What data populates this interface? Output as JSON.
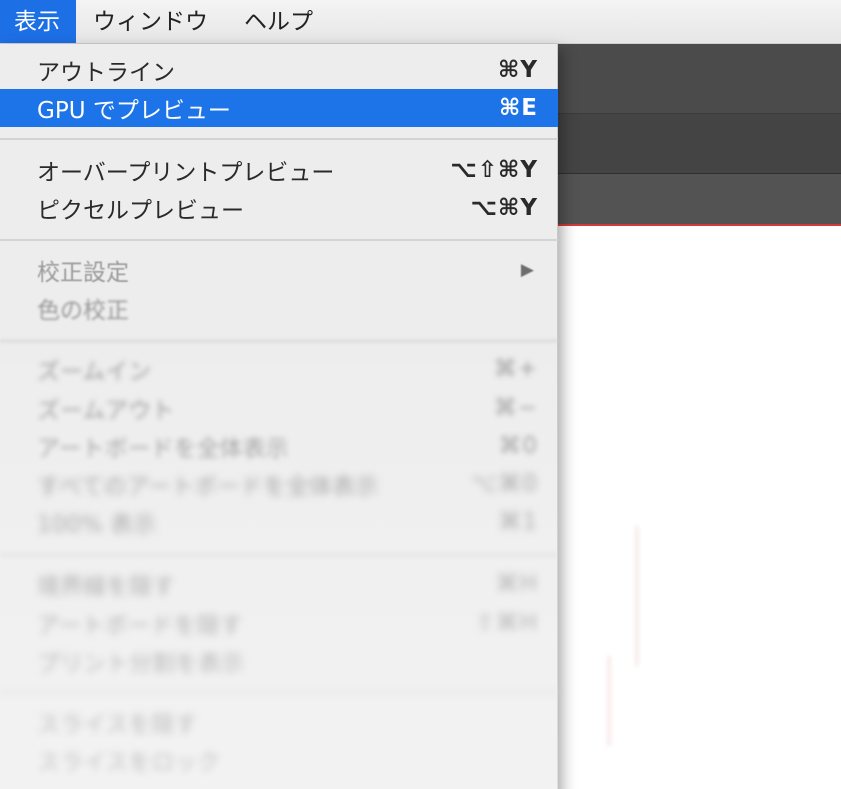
{
  "menubar": {
    "items": [
      {
        "label": "表示",
        "active": true
      },
      {
        "label": "ウィンドウ",
        "active": false
      },
      {
        "label": "ヘルプ",
        "active": false
      }
    ]
  },
  "menu": {
    "groups": [
      [
        {
          "label": "アウトライン",
          "shortcut": "⌘Y",
          "state": "normal"
        },
        {
          "label": "GPU でプレビュー",
          "shortcut": "⌘E",
          "state": "selected"
        }
      ],
      [
        {
          "label": "オーバープリントプレビュー",
          "shortcut": "⌥⇧⌘Y",
          "state": "normal"
        },
        {
          "label": "ピクセルプレビュー",
          "shortcut": "⌥⌘Y",
          "state": "normal"
        }
      ],
      [
        {
          "label": "校正設定",
          "shortcut": "",
          "submenu_icon": "submenu-arrow-icon",
          "state": "disabled"
        },
        {
          "label": "色の校正",
          "shortcut": "",
          "state": "disabled"
        }
      ],
      [
        {
          "label": "ズームイン",
          "shortcut": "⌘+",
          "state": "disabled"
        },
        {
          "label": "ズームアウト",
          "shortcut": "⌘−",
          "state": "disabled"
        },
        {
          "label": "アートボードを全体表示",
          "shortcut": "⌘0",
          "state": "disabled"
        },
        {
          "label": "すべてのアートボードを全体表示",
          "shortcut": "⌥⌘0",
          "state": "disabled"
        },
        {
          "label": "100% 表示",
          "shortcut": "⌘1",
          "state": "disabled"
        }
      ],
      [
        {
          "label": "境界線を隠す",
          "shortcut": "⌘H",
          "state": "disabled"
        },
        {
          "label": "アートボードを隠す",
          "shortcut": "⇧⌘H",
          "state": "disabled"
        },
        {
          "label": "プリント分割を表示",
          "shortcut": "",
          "state": "disabled"
        }
      ],
      [
        {
          "label": "スライスを隠す",
          "shortcut": "",
          "state": "disabled"
        },
        {
          "label": "スライスをロック",
          "shortcut": "",
          "state": "disabled"
        }
      ]
    ]
  },
  "colors": {
    "selection": "#1d74e8",
    "active_menubar": "#1d6fe6",
    "disabled_text": "#9a9a9a"
  }
}
